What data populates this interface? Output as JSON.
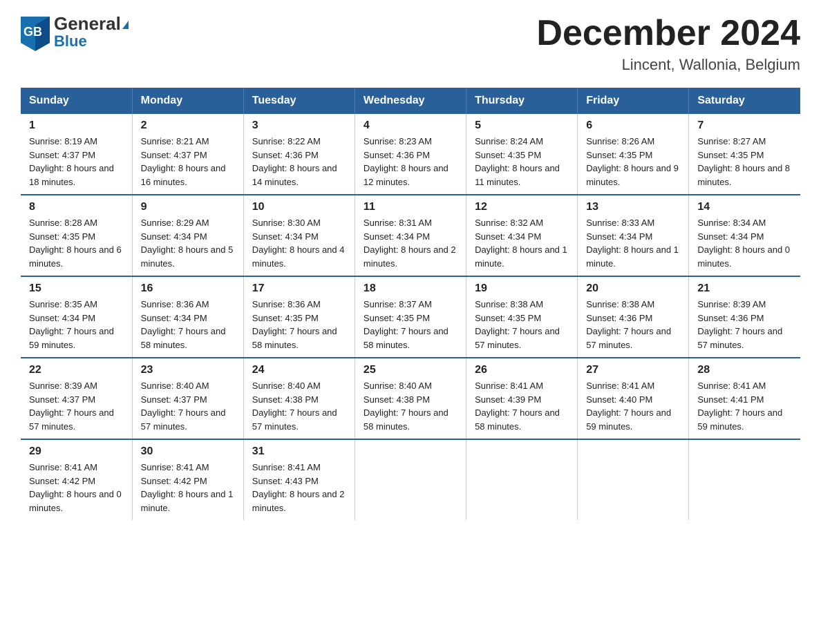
{
  "header": {
    "logo_general": "General",
    "logo_blue": "Blue",
    "month_title": "December 2024",
    "location": "Lincent, Wallonia, Belgium"
  },
  "days_of_week": [
    "Sunday",
    "Monday",
    "Tuesday",
    "Wednesday",
    "Thursday",
    "Friday",
    "Saturday"
  ],
  "weeks": [
    [
      {
        "day": "1",
        "sunrise": "Sunrise: 8:19 AM",
        "sunset": "Sunset: 4:37 PM",
        "daylight": "Daylight: 8 hours and 18 minutes."
      },
      {
        "day": "2",
        "sunrise": "Sunrise: 8:21 AM",
        "sunset": "Sunset: 4:37 PM",
        "daylight": "Daylight: 8 hours and 16 minutes."
      },
      {
        "day": "3",
        "sunrise": "Sunrise: 8:22 AM",
        "sunset": "Sunset: 4:36 PM",
        "daylight": "Daylight: 8 hours and 14 minutes."
      },
      {
        "day": "4",
        "sunrise": "Sunrise: 8:23 AM",
        "sunset": "Sunset: 4:36 PM",
        "daylight": "Daylight: 8 hours and 12 minutes."
      },
      {
        "day": "5",
        "sunrise": "Sunrise: 8:24 AM",
        "sunset": "Sunset: 4:35 PM",
        "daylight": "Daylight: 8 hours and 11 minutes."
      },
      {
        "day": "6",
        "sunrise": "Sunrise: 8:26 AM",
        "sunset": "Sunset: 4:35 PM",
        "daylight": "Daylight: 8 hours and 9 minutes."
      },
      {
        "day": "7",
        "sunrise": "Sunrise: 8:27 AM",
        "sunset": "Sunset: 4:35 PM",
        "daylight": "Daylight: 8 hours and 8 minutes."
      }
    ],
    [
      {
        "day": "8",
        "sunrise": "Sunrise: 8:28 AM",
        "sunset": "Sunset: 4:35 PM",
        "daylight": "Daylight: 8 hours and 6 minutes."
      },
      {
        "day": "9",
        "sunrise": "Sunrise: 8:29 AM",
        "sunset": "Sunset: 4:34 PM",
        "daylight": "Daylight: 8 hours and 5 minutes."
      },
      {
        "day": "10",
        "sunrise": "Sunrise: 8:30 AM",
        "sunset": "Sunset: 4:34 PM",
        "daylight": "Daylight: 8 hours and 4 minutes."
      },
      {
        "day": "11",
        "sunrise": "Sunrise: 8:31 AM",
        "sunset": "Sunset: 4:34 PM",
        "daylight": "Daylight: 8 hours and 2 minutes."
      },
      {
        "day": "12",
        "sunrise": "Sunrise: 8:32 AM",
        "sunset": "Sunset: 4:34 PM",
        "daylight": "Daylight: 8 hours and 1 minute."
      },
      {
        "day": "13",
        "sunrise": "Sunrise: 8:33 AM",
        "sunset": "Sunset: 4:34 PM",
        "daylight": "Daylight: 8 hours and 1 minute."
      },
      {
        "day": "14",
        "sunrise": "Sunrise: 8:34 AM",
        "sunset": "Sunset: 4:34 PM",
        "daylight": "Daylight: 8 hours and 0 minutes."
      }
    ],
    [
      {
        "day": "15",
        "sunrise": "Sunrise: 8:35 AM",
        "sunset": "Sunset: 4:34 PM",
        "daylight": "Daylight: 7 hours and 59 minutes."
      },
      {
        "day": "16",
        "sunrise": "Sunrise: 8:36 AM",
        "sunset": "Sunset: 4:34 PM",
        "daylight": "Daylight: 7 hours and 58 minutes."
      },
      {
        "day": "17",
        "sunrise": "Sunrise: 8:36 AM",
        "sunset": "Sunset: 4:35 PM",
        "daylight": "Daylight: 7 hours and 58 minutes."
      },
      {
        "day": "18",
        "sunrise": "Sunrise: 8:37 AM",
        "sunset": "Sunset: 4:35 PM",
        "daylight": "Daylight: 7 hours and 58 minutes."
      },
      {
        "day": "19",
        "sunrise": "Sunrise: 8:38 AM",
        "sunset": "Sunset: 4:35 PM",
        "daylight": "Daylight: 7 hours and 57 minutes."
      },
      {
        "day": "20",
        "sunrise": "Sunrise: 8:38 AM",
        "sunset": "Sunset: 4:36 PM",
        "daylight": "Daylight: 7 hours and 57 minutes."
      },
      {
        "day": "21",
        "sunrise": "Sunrise: 8:39 AM",
        "sunset": "Sunset: 4:36 PM",
        "daylight": "Daylight: 7 hours and 57 minutes."
      }
    ],
    [
      {
        "day": "22",
        "sunrise": "Sunrise: 8:39 AM",
        "sunset": "Sunset: 4:37 PM",
        "daylight": "Daylight: 7 hours and 57 minutes."
      },
      {
        "day": "23",
        "sunrise": "Sunrise: 8:40 AM",
        "sunset": "Sunset: 4:37 PM",
        "daylight": "Daylight: 7 hours and 57 minutes."
      },
      {
        "day": "24",
        "sunrise": "Sunrise: 8:40 AM",
        "sunset": "Sunset: 4:38 PM",
        "daylight": "Daylight: 7 hours and 57 minutes."
      },
      {
        "day": "25",
        "sunrise": "Sunrise: 8:40 AM",
        "sunset": "Sunset: 4:38 PM",
        "daylight": "Daylight: 7 hours and 58 minutes."
      },
      {
        "day": "26",
        "sunrise": "Sunrise: 8:41 AM",
        "sunset": "Sunset: 4:39 PM",
        "daylight": "Daylight: 7 hours and 58 minutes."
      },
      {
        "day": "27",
        "sunrise": "Sunrise: 8:41 AM",
        "sunset": "Sunset: 4:40 PM",
        "daylight": "Daylight: 7 hours and 59 minutes."
      },
      {
        "day": "28",
        "sunrise": "Sunrise: 8:41 AM",
        "sunset": "Sunset: 4:41 PM",
        "daylight": "Daylight: 7 hours and 59 minutes."
      }
    ],
    [
      {
        "day": "29",
        "sunrise": "Sunrise: 8:41 AM",
        "sunset": "Sunset: 4:42 PM",
        "daylight": "Daylight: 8 hours and 0 minutes."
      },
      {
        "day": "30",
        "sunrise": "Sunrise: 8:41 AM",
        "sunset": "Sunset: 4:42 PM",
        "daylight": "Daylight: 8 hours and 1 minute."
      },
      {
        "day": "31",
        "sunrise": "Sunrise: 8:41 AM",
        "sunset": "Sunset: 4:43 PM",
        "daylight": "Daylight: 8 hours and 2 minutes."
      },
      {
        "day": "",
        "sunrise": "",
        "sunset": "",
        "daylight": ""
      },
      {
        "day": "",
        "sunrise": "",
        "sunset": "",
        "daylight": ""
      },
      {
        "day": "",
        "sunrise": "",
        "sunset": "",
        "daylight": ""
      },
      {
        "day": "",
        "sunrise": "",
        "sunset": "",
        "daylight": ""
      }
    ]
  ]
}
